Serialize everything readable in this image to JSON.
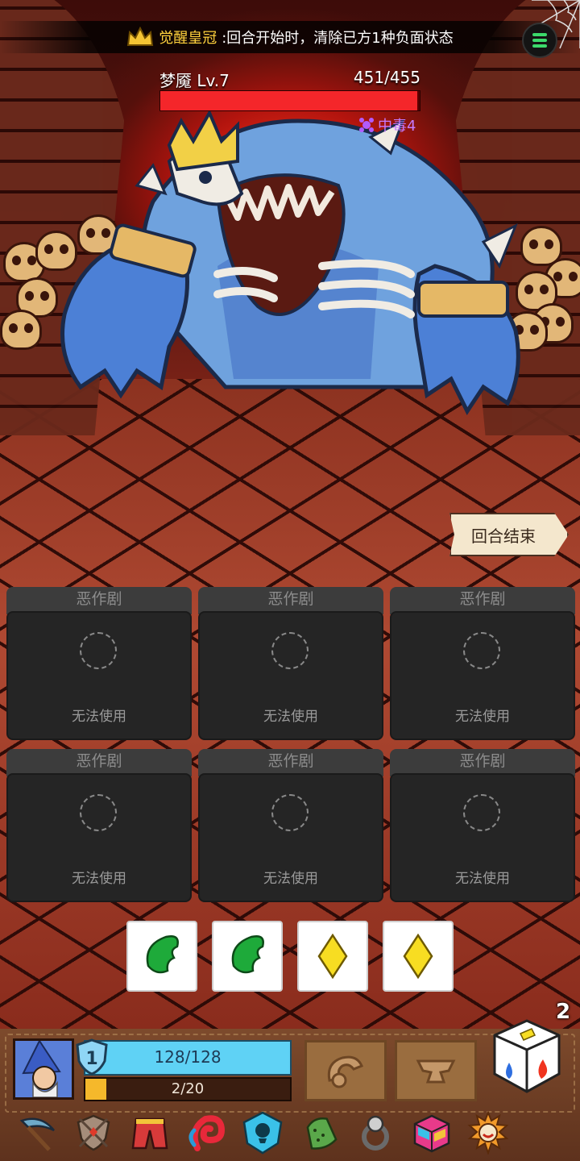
{
  "banner": {
    "relic_name": "觉醒皇冠",
    "relic_desc": ":回合开始时，清除已方1种负面状态"
  },
  "enemy": {
    "name": "梦魇 Lv.7",
    "hp_text": "451/455",
    "hp_current": 451,
    "hp_max": 455,
    "status": "中毒4"
  },
  "end_turn_label": "回合结束",
  "card_slots": [
    {
      "title": "恶作剧",
      "note": "无法使用"
    },
    {
      "title": "恶作剧",
      "note": "无法使用"
    },
    {
      "title": "恶作剧",
      "note": "无法使用"
    },
    {
      "title": "恶作剧",
      "note": "无法使用"
    },
    {
      "title": "恶作剧",
      "note": "无法使用"
    },
    {
      "title": "恶作剧",
      "note": "无法使用"
    }
  ],
  "dice": [
    "leaf-icon",
    "leaf-icon",
    "diamond-icon",
    "diamond-icon"
  ],
  "player": {
    "shield_level": "1",
    "hp_text": "128/128",
    "hp_current": 128,
    "hp_max": 128,
    "xp_text": "2/20"
  },
  "dice_count": "2",
  "colors": {
    "enemy_hp": "#f4262a",
    "player_hp": "#5fd2f5",
    "status_poison": "#c57bff",
    "relic_name": "#ffd23d"
  },
  "relics": [
    "scythe-icon",
    "shield-sword-icon",
    "red-pants-icon",
    "red-swirl-icon",
    "blue-skull-gem-icon",
    "green-cactus-icon",
    "ring-icon",
    "rainbow-cube-icon",
    "sun-mask-icon"
  ]
}
